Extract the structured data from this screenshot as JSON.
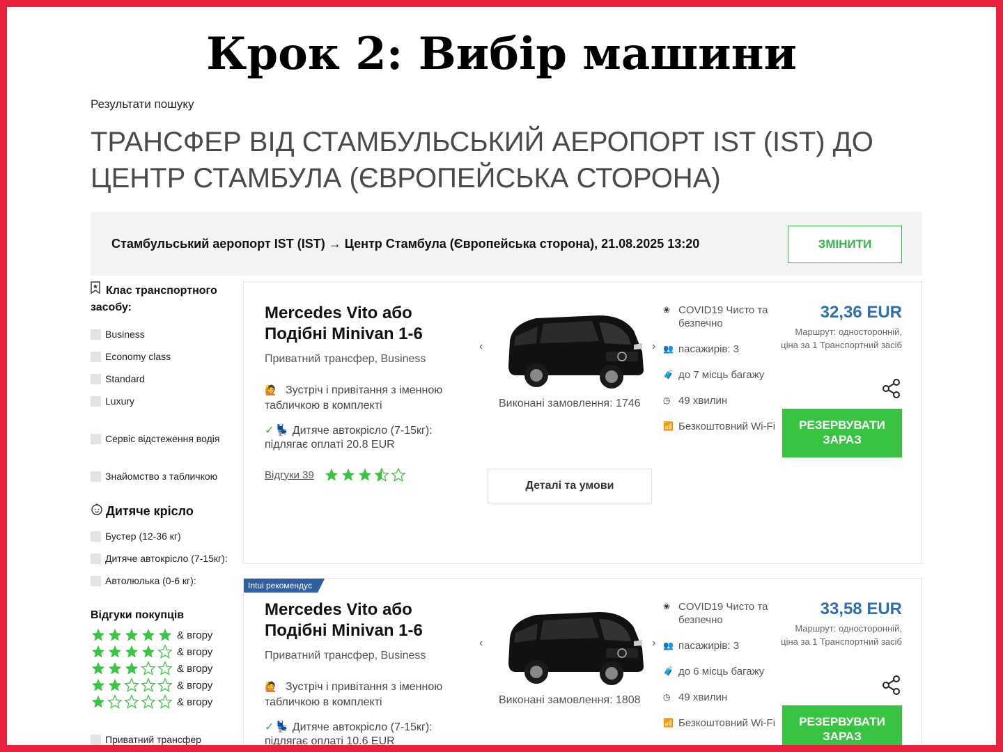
{
  "step_title": "Крок 2: Вибір машини",
  "results_label": "Результати пошуку",
  "route_heading": "ТРАНСФЕР ВІД СТАМБУЛЬСЬКИЙ АЕРОПОРТ IST (IST) ДО ЦЕНТР СТАМБУЛА (ЄВРОПЕЙСЬКА СТОРОНА)",
  "route_bar": {
    "text": "Стамбульський аеропорт IST (IST) → Центр Стамбула (Європейська сторона), 21.08.2025 13:20",
    "change_label": "ЗМІНИТИ"
  },
  "sidebar": {
    "vehicle_class": {
      "title": "Клас транспортного засобу:",
      "icon": "bookmark-star-icon",
      "options": [
        "Business",
        "Economy class",
        "Standard",
        "Luxury"
      ]
    },
    "driver_tracking": "Сервіс відстеження водія",
    "meet_sign": "Знайомство з табличкою",
    "child_seat": {
      "title": "Дитяче крісло",
      "icon": "baby-face-icon",
      "options": [
        "Бустер (12-36 кг)",
        "Дитяче автокрісло (7-15кг):",
        "Автолюлька (0-6 кг):"
      ]
    },
    "reviews": {
      "title": "Відгуки покупців",
      "suffix": "& вгору",
      "levels": [
        5,
        4,
        3,
        2,
        1
      ]
    },
    "private_transfer": "Приватний трансфер"
  },
  "cards": [
    {
      "badge": "",
      "name": "Mercedes Vito або Подібні Minivan 1-6",
      "type": "Приватний трансфер, Business",
      "meet": "Зустріч і привітання з іменною табличкою в комплекті",
      "seat": "Дитяче автокрісло (7-15кг): підлягає оплаті 20.8 EUR",
      "reviews_label": "Відгуки 39",
      "rating": 3.5,
      "orders": "Виконані замовлення: 1746",
      "details_label": "Деталі та умови",
      "features": {
        "covid": "COVID19 Чисто та безпечно",
        "passengers": "пасажирів: 3",
        "luggage": "до 7 місць багажу",
        "duration": "49 хвилин",
        "wifi": "Безкоштовний Wi-Fi"
      },
      "price": "32,36 EUR",
      "price_note": "Маршрут: односторонній, ціна за 1 Транспортний засіб",
      "book_label": "РЕЗЕРВУВАТИ ЗАРАЗ"
    },
    {
      "badge": "Intui рекомендує",
      "name": "Mercedes Vito або Подібні Minivan 1-6",
      "type": "Приватний трансфер, Business",
      "meet": "Зустріч і привітання з іменною табличкою в комплекті",
      "seat": "Дитяче автокрісло (7-15кг): підлягає оплаті 10.6 EUR",
      "orders": "Виконані замовлення: 1808",
      "features": {
        "covid": "COVID19 Чисто та безпечно",
        "passengers": "пасажирів: 3",
        "luggage": "до 6 місць багажу",
        "duration": "49 хвилин",
        "wifi": "Безкоштовний Wi-Fi"
      },
      "price": "33,58 EUR",
      "price_note": "Маршрут: односторонній, ціна за 1 Транспортний засіб",
      "book_label": "РЕЗЕРВУВАТИ ЗАРАЗ"
    }
  ],
  "colors": {
    "frame": "#e8223f",
    "accent_green": "#38c343",
    "price_blue": "#2f6fb0",
    "badge_blue": "#2f5f9e"
  }
}
